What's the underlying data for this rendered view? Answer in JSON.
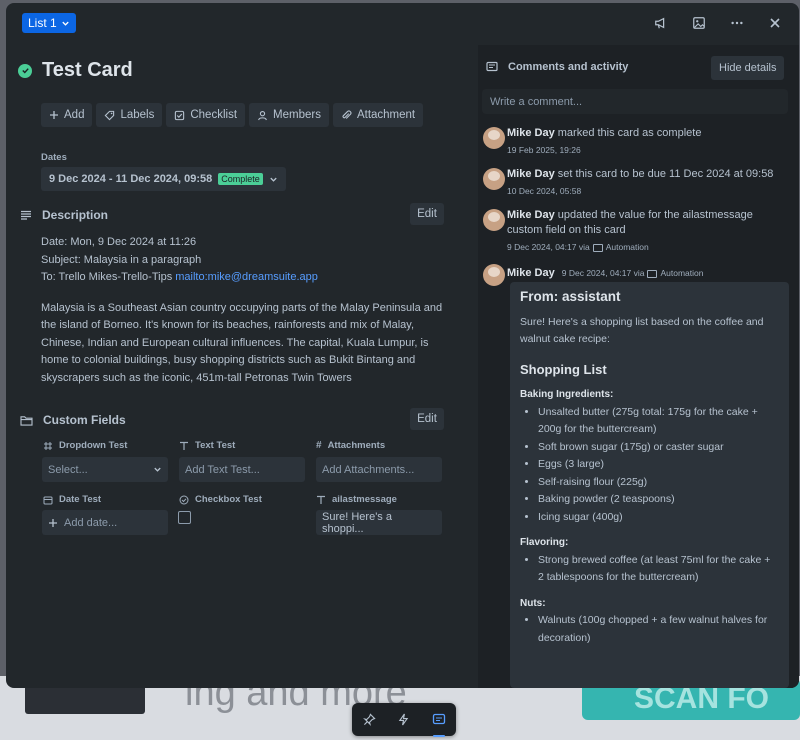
{
  "background": {
    "text": "ing and more",
    "teal_text": "SCAN FO"
  },
  "header": {
    "list_label": "List 1"
  },
  "card": {
    "title": "Test Card",
    "status_color": "#4bce97"
  },
  "actions": [
    {
      "label": "Add",
      "icon": "plus-icon"
    },
    {
      "label": "Labels",
      "icon": "tag-icon"
    },
    {
      "label": "Checklist",
      "icon": "checklist-icon"
    },
    {
      "label": "Members",
      "icon": "person-icon"
    },
    {
      "label": "Attachment",
      "icon": "paperclip-icon"
    }
  ],
  "dates": {
    "label": "Dates",
    "value": "9 Dec 2024 - 11 Dec 2024, 09:58",
    "badge": "Complete"
  },
  "description": {
    "heading": "Description",
    "edit_label": "Edit",
    "line1": "Date: Mon, 9 Dec 2024 at 11:26",
    "line2": "Subject: Malaysia in a paragraph",
    "line3_prefix": "To: Trello Mikes-Trello-Tips ",
    "line3_link": "mailto:mike@dreamsuite.app",
    "paragraph": "Malaysia is a Southeast Asian country occupying parts of the Malay Peninsula and the island of Borneo. It's known for its beaches, rainforests and mix of Malay, Chinese, Indian and European cultural influences. The capital, Kuala Lumpur, is home to colonial buildings, busy shopping districts such as Bukit Bintang and skyscrapers such as the iconic, 451m-tall Petronas Twin Towers"
  },
  "custom_fields": {
    "heading": "Custom Fields",
    "edit_label": "Edit",
    "dropdown": {
      "label": "Dropdown Test",
      "placeholder": "Select..."
    },
    "text": {
      "label": "Text Test",
      "placeholder": "Add Text Test..."
    },
    "attachments": {
      "label": "Attachments",
      "placeholder": "Add Attachments..."
    },
    "date": {
      "label": "Date Test",
      "placeholder": "Add date..."
    },
    "checkbox": {
      "label": "Checkbox Test"
    },
    "ailast": {
      "label": "ailastmessage",
      "value": "Sure! Here's a shoppi..."
    }
  },
  "comments": {
    "heading": "Comments and activity",
    "hide_label": "Hide details",
    "input_placeholder": "Write a comment...",
    "activity": [
      {
        "user": "Mike Day",
        "text": " marked this card as complete",
        "time": "19 Feb 2025, 19:26"
      },
      {
        "user": "Mike Day",
        "text": " set this card to be due 11 Dec 2024 at 09:58",
        "time": "10 Dec 2024, 05:58"
      },
      {
        "user": "Mike Day",
        "text": " updated the value for the ailastmessage custom field on this card",
        "time": "9 Dec 2024, 04:17 via",
        "via": "Automation"
      }
    ],
    "comment": {
      "user": "Mike Day",
      "time": "9 Dec 2024, 04:17 via",
      "via": "Automation",
      "from": "From: assistant",
      "intro": "Sure! Here's a shopping list based on the coffee and walnut cake recipe:",
      "list_title": "Shopping List",
      "groups": [
        {
          "title": "Baking Ingredients:",
          "items": [
            "Unsalted butter (275g total: 175g for the cake + 200g for the buttercream)",
            "Soft brown sugar (175g) or caster sugar",
            "Eggs (3 large)",
            "Self-raising flour (225g)",
            "Baking powder (2 teaspoons)",
            "Icing sugar (400g)"
          ]
        },
        {
          "title": "Flavoring:",
          "items": [
            "Strong brewed coffee (at least 75ml for the cake + 2 tablespoons for the buttercream)"
          ]
        },
        {
          "title": "Nuts:",
          "items": [
            "Walnuts (100g chopped + a few walnut halves for decoration)"
          ]
        }
      ]
    }
  }
}
